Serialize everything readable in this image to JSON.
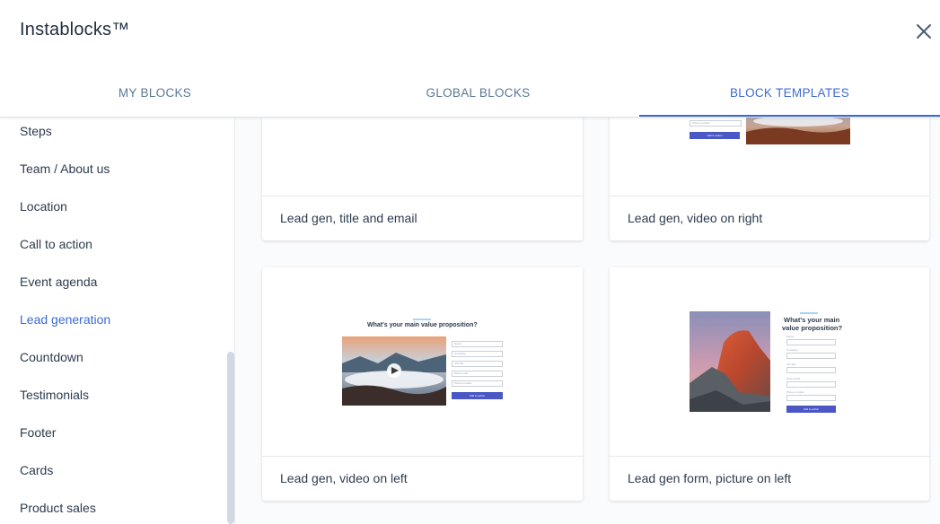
{
  "app": {
    "title": "Instablocks™"
  },
  "tabs": [
    {
      "label": "MY BLOCKS",
      "active": false
    },
    {
      "label": "GLOBAL BLOCKS",
      "active": false
    },
    {
      "label": "BLOCK TEMPLATES",
      "active": true
    }
  ],
  "sidebar": {
    "items": [
      {
        "label": "Steps",
        "active": false
      },
      {
        "label": "Team / About us",
        "active": false
      },
      {
        "label": "Location",
        "active": false
      },
      {
        "label": "Call to action",
        "active": false
      },
      {
        "label": "Event agenda",
        "active": false
      },
      {
        "label": "Lead generation",
        "active": true
      },
      {
        "label": "Countdown",
        "active": false
      },
      {
        "label": "Testimonials",
        "active": false
      },
      {
        "label": "Footer",
        "active": false
      },
      {
        "label": "Cards",
        "active": false
      },
      {
        "label": "Product sales",
        "active": false
      }
    ]
  },
  "templates": [
    {
      "caption": "Lead gen, title and email"
    },
    {
      "caption": "Lead gen, video on right",
      "preview": {
        "field_text": "Phone number",
        "button_text": "Call to action"
      }
    },
    {
      "caption": "Lead gen, video on left",
      "preview": {
        "heading": "What's your main value proposition?",
        "fields": [
          "Name",
          "Company",
          "Job title",
          "Work email",
          "Phone number"
        ],
        "button_text": "Call to action"
      }
    },
    {
      "caption": "Lead gen form, picture on left",
      "preview": {
        "heading_line1": "What's your main",
        "heading_line2": "value proposition?",
        "labels": [
          "Name",
          "Company",
          "Job title",
          "Work email",
          "Phone number"
        ],
        "button_text": "Call to action"
      }
    }
  ],
  "colors": {
    "accent": "#3c6bd1",
    "tab_inactive": "#5b7896",
    "text": "#2d3b4e",
    "cta": "#4a57c4"
  },
  "icons": {
    "close": "close-icon",
    "play": "play-icon"
  }
}
